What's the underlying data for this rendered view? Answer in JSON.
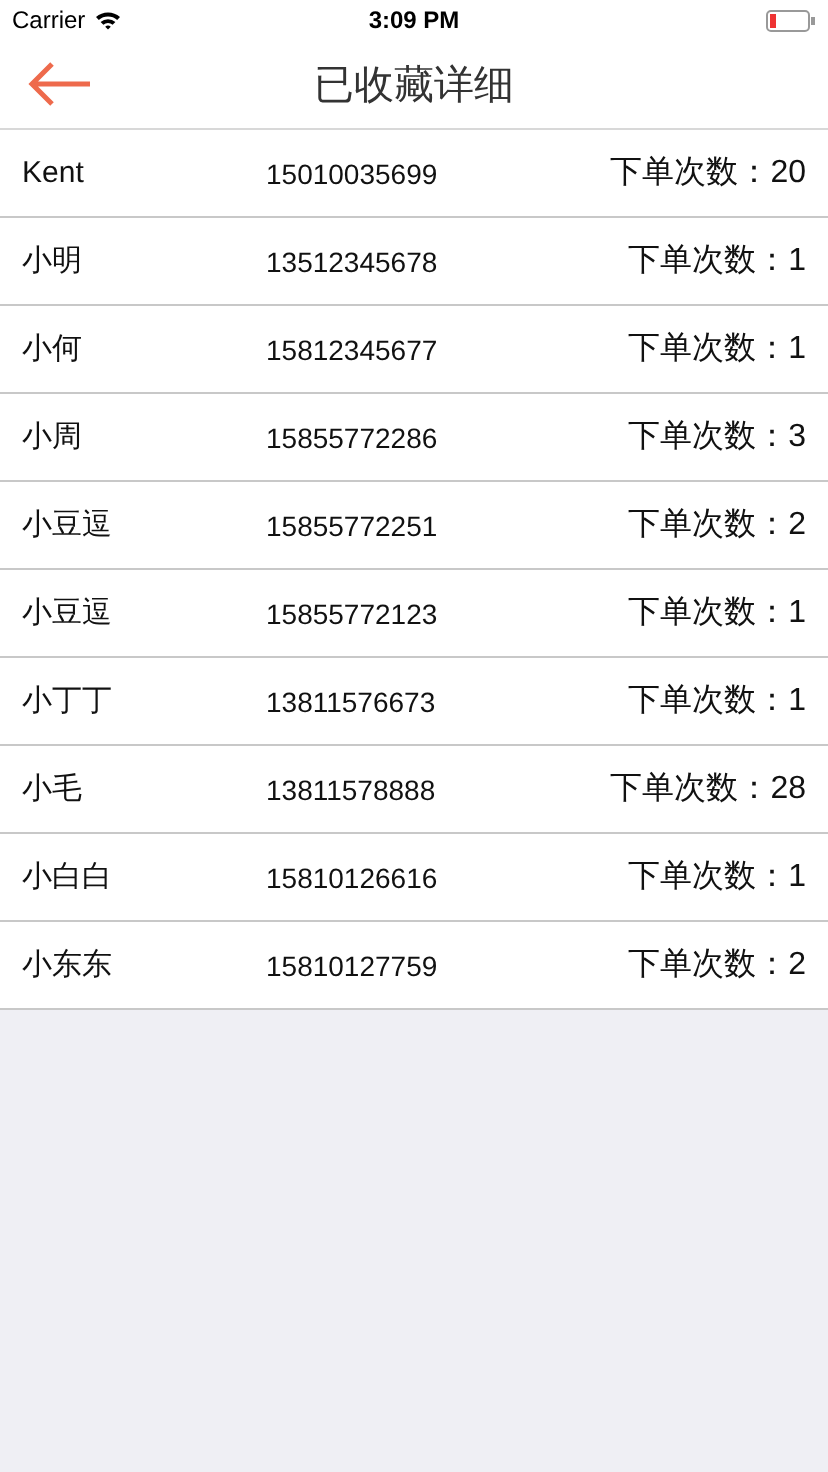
{
  "status_bar": {
    "carrier": "Carrier",
    "time": "3:09 PM"
  },
  "nav_bar": {
    "title": "已收藏详细"
  },
  "rows": [
    {
      "name": "Kent",
      "phone": "15010035699",
      "orders": "下单次数：20"
    },
    {
      "name": "小明",
      "phone": "13512345678",
      "orders": "下单次数：1"
    },
    {
      "name": "小何",
      "phone": "15812345677",
      "orders": "下单次数：1"
    },
    {
      "name": "小周",
      "phone": "15855772286",
      "orders": "下单次数：3"
    },
    {
      "name": "小豆逗",
      "phone": "15855772251",
      "orders": "下单次数：2"
    },
    {
      "name": "小豆逗",
      "phone": "15855772123",
      "orders": "下单次数：1"
    },
    {
      "name": "小丁丁",
      "phone": "13811576673",
      "orders": "下单次数：1"
    },
    {
      "name": "小毛",
      "phone": "13811578888",
      "orders": "下单次数：28"
    },
    {
      "name": "小白白",
      "phone": "15810126616",
      "orders": "下单次数：1"
    },
    {
      "name": "小东东",
      "phone": "15810127759",
      "orders": "下单次数：2"
    }
  ]
}
